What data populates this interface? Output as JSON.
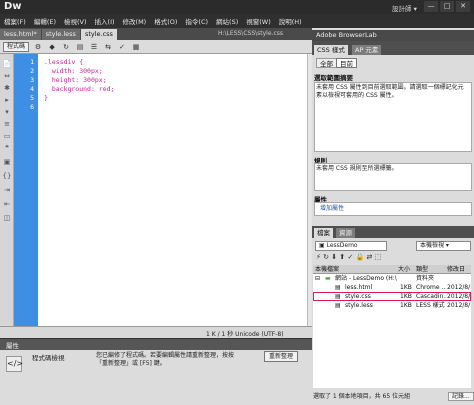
{
  "app": {
    "logo": "Dw",
    "workspace": "設計師 ▾",
    "win_buttons": [
      "—",
      "□",
      "✕"
    ]
  },
  "menu": [
    "檔案(F)",
    "編輯(E)",
    "檢視(V)",
    "插入(I)",
    "修改(M)",
    "格式(O)",
    "指令(C)",
    "網站(S)",
    "視窗(W)",
    "說明(H)"
  ],
  "doc_tabs": [
    {
      "label": "less.html*",
      "active": false
    },
    {
      "label": "style.less",
      "active": false
    },
    {
      "label": "style.css",
      "active": true
    }
  ],
  "file_path": "H:\\LESS\\CSS\\style.css",
  "toolbar": {
    "code_btn": "程式碼",
    "icons": [
      "⚙",
      "◆",
      "↻",
      "▤",
      "☰",
      "⇆",
      "✓",
      "▦"
    ]
  },
  "gutter_icons": [
    "📄",
    "⇔",
    "✱",
    "▸",
    "▾",
    "≡",
    "▭",
    "❝",
    "▣",
    "{}",
    "⇥",
    "⇤",
    "◫"
  ],
  "code": {
    "line_numbers": [
      "1",
      "2",
      "3",
      "4",
      "5",
      "6"
    ],
    "lines": [
      ".lessdiv {",
      "  width: 300px;",
      "  height: 300px;",
      "  background: red;",
      "}",
      ""
    ]
  },
  "status": {
    "text": "1 K / 1 秒  Unicode (UTF-8)"
  },
  "properties": {
    "title": "屬性",
    "label": "程式碼檢視",
    "text": "您已編修了程式碼。若要編輯屬性請重新整理，按按「重新整理」或 [F5] 鍵。",
    "refresh_btn": "重新整理"
  },
  "right": {
    "browserlab_title": "Adobe BrowserLab",
    "css_tabs": [
      {
        "label": "CSS 樣式",
        "active": true
      },
      {
        "label": "AP 元素",
        "active": false
      }
    ],
    "mode_tabs": [
      {
        "label": "全部",
        "active": false
      },
      {
        "label": "目前",
        "active": true
      }
    ],
    "summary_title": "選取範圍摘要",
    "summary_text": "未套用 CSS 屬性到目前選取範圍。請選取一個標記化元素以檢視可套用的 CSS 屬性。",
    "rules_title": "規則",
    "rules_text": "未套用 CSS 規則至所選標籤。",
    "props_title": "屬性",
    "add_property": "增加屬性"
  },
  "files": {
    "tabs": [
      {
        "label": "檔案",
        "active": true
      },
      {
        "label": "資源",
        "active": false
      }
    ],
    "site": "LessDemo",
    "view": "本機檢視",
    "headers": [
      "本機檔案",
      "大小",
      "類型",
      "修改日"
    ],
    "rows": [
      {
        "name": "網站 - LessDemo (H:\\LESS)",
        "size": "",
        "type": "資料夾",
        "date": "",
        "indent": 0,
        "icon": "folder-icon"
      },
      {
        "name": "less.html",
        "size": "1KB",
        "type": "Chrome ...",
        "date": "2012/8/1",
        "indent": 1,
        "icon": "html-file-icon"
      },
      {
        "name": "style.css",
        "size": "1KB",
        "type": "Cascadin...",
        "date": "2012/8/1",
        "indent": 1,
        "icon": "css-file-icon"
      },
      {
        "name": "style.less",
        "size": "1KB",
        "type": "LESS 樣式",
        "date": "2012/8/1",
        "indent": 1,
        "icon": "less-file-icon"
      }
    ],
    "status": "選取了 1 個本地項目，共 65 位元組",
    "log_btn": "記錄..."
  },
  "colors": {
    "accent_blue": "#3d8fe6",
    "highlight": "#d81b60",
    "code_pink": "#c0268e"
  }
}
